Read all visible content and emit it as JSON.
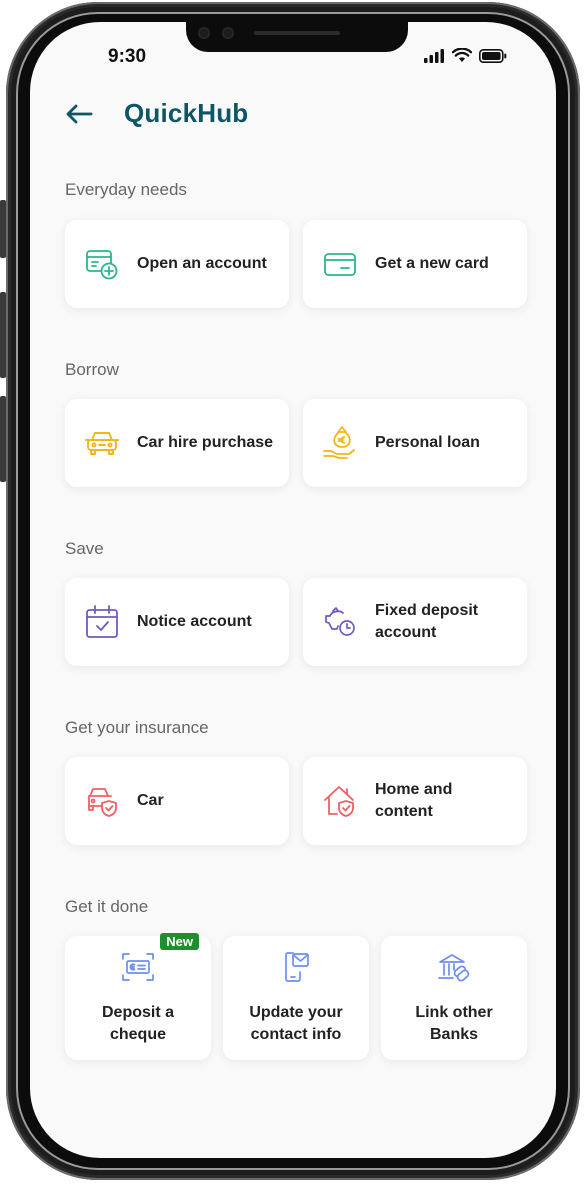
{
  "status_bar": {
    "time": "9:30"
  },
  "header": {
    "title": "QuickHub"
  },
  "sections": {
    "everyday": {
      "label": "Everyday needs",
      "items": [
        {
          "label": "Open an account"
        },
        {
          "label": "Get a new card"
        }
      ]
    },
    "borrow": {
      "label": "Borrow",
      "items": [
        {
          "label": "Car hire purchase"
        },
        {
          "label": "Personal loan"
        }
      ]
    },
    "save": {
      "label": "Save",
      "items": [
        {
          "label": "Notice account"
        },
        {
          "label": "Fixed deposit account"
        }
      ]
    },
    "insurance": {
      "label": "Get your insurance",
      "items": [
        {
          "label": "Car"
        },
        {
          "label": "Home and content"
        }
      ]
    },
    "done": {
      "label": "Get it done",
      "badge": "New",
      "items": [
        {
          "label": "Deposit a cheque"
        },
        {
          "label": "Update your contact info"
        },
        {
          "label": "Link other Banks"
        }
      ]
    }
  },
  "icons": {
    "open_account": "account-add-icon",
    "new_card": "card-icon",
    "car_hire": "car-icon",
    "personal_loan": "money-bag-icon",
    "notice_account": "calendar-check-icon",
    "fixed_deposit": "piggy-clock-icon",
    "car_insurance": "car-shield-icon",
    "home_insurance": "home-shield-icon",
    "deposit_cheque": "scan-cheque-icon",
    "contact_info": "phone-mail-icon",
    "link_banks": "bank-link-icon"
  },
  "colors": {
    "title": "#0d5665",
    "teal": "#2bb58f",
    "amber": "#f2b619",
    "purple": "#7357c4",
    "coral": "#ef6166",
    "blue": "#6d8ff1",
    "badge": "#1e8e2e"
  }
}
